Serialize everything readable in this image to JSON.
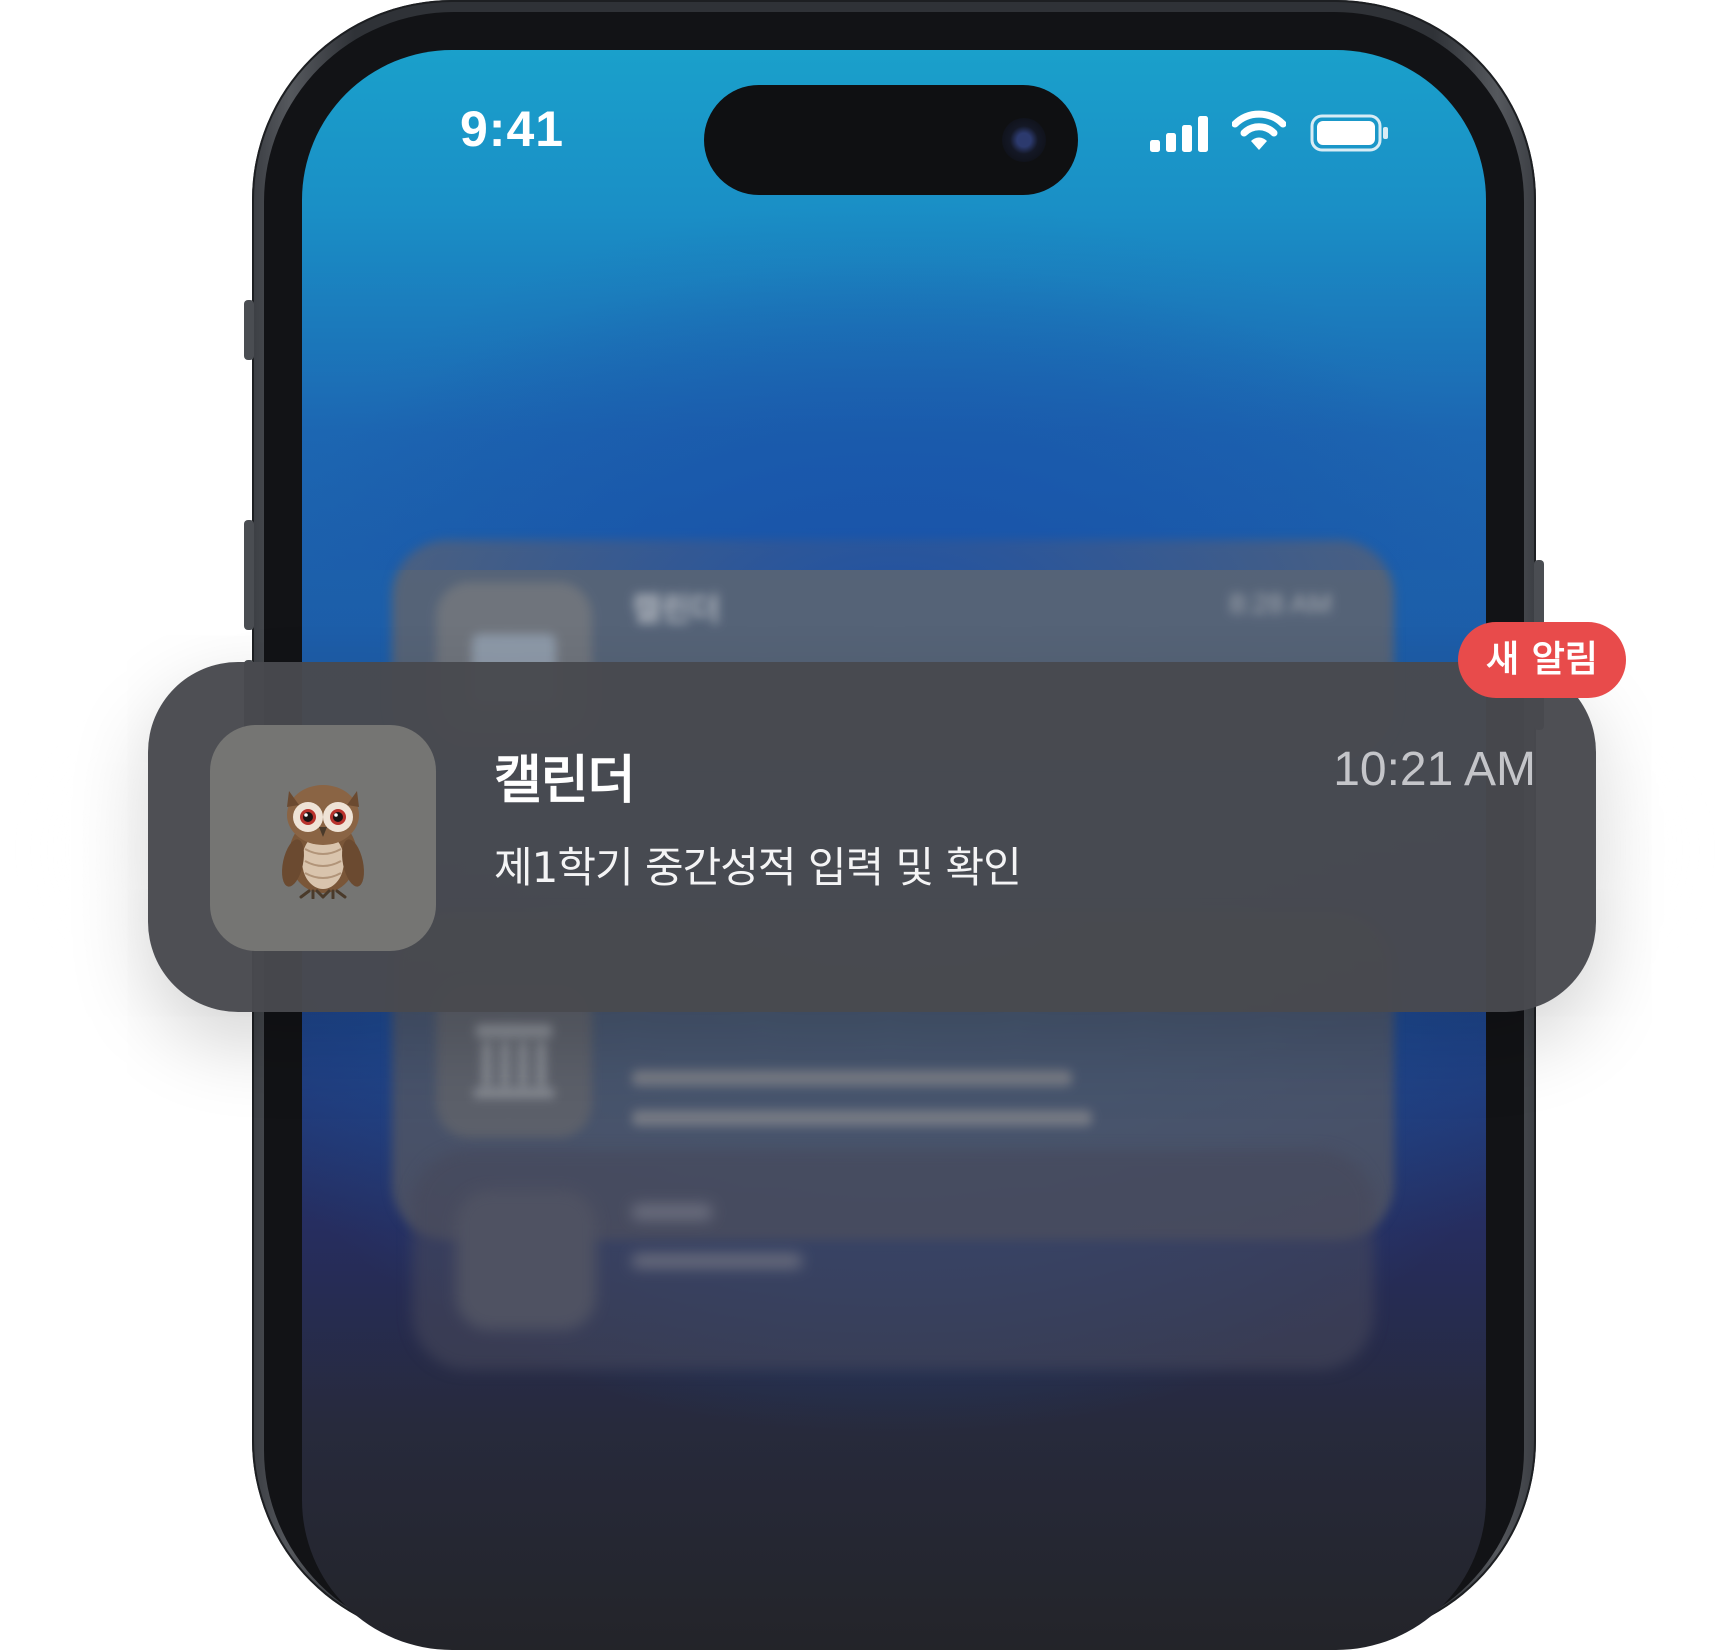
{
  "status_bar": {
    "time": "9:41",
    "signal_icon": "cellular-signal-icon",
    "wifi_icon": "wifi-icon",
    "battery_icon": "battery-icon"
  },
  "background_notifications": [
    {
      "app_name": "캘린더",
      "time": "8:28 AM",
      "icon": "calendar-icon"
    },
    {
      "icon": "bank-icon"
    },
    {
      "icon": "bank-icon"
    }
  ],
  "notification": {
    "app_name": "캘린더",
    "time": "10:21 AM",
    "message": "제1학기 중간성적 입력 및 확인",
    "icon": "owl-icon",
    "badge": "새 알림"
  },
  "colors": {
    "badge": "#e84b4b",
    "notification_bg": "#48494e",
    "screen_top": "#1aa0cb",
    "screen_bottom": "#232429"
  }
}
